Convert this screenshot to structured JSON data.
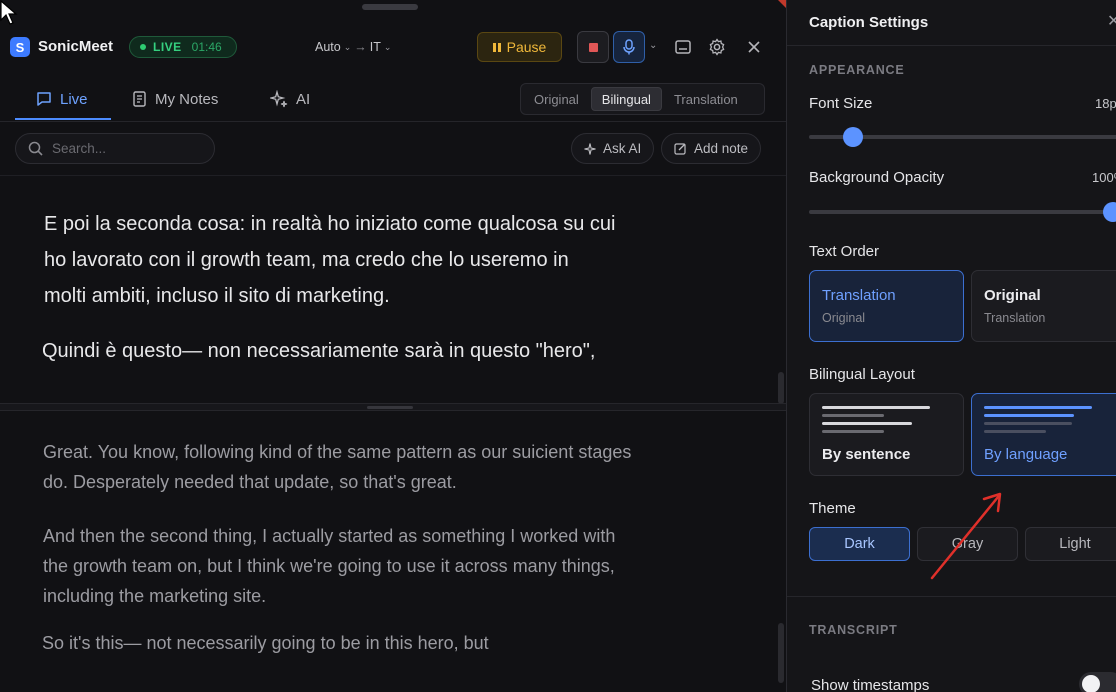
{
  "app": {
    "name": "SonicMeet",
    "logo_letter": "S",
    "live_label": "LIVE",
    "elapsed": "01:46",
    "source_lang": "Auto",
    "lang_separator": "→",
    "target_lang": "IT",
    "pause_label": "Pause"
  },
  "tabs": [
    {
      "label": "Live",
      "icon": "chat-icon",
      "active": true
    },
    {
      "label": "My Notes",
      "icon": "notes-icon",
      "active": false
    },
    {
      "label": "AI",
      "icon": "sparkles-icon",
      "active": false
    }
  ],
  "modes": [
    "Original",
    "Bilingual",
    "Translation"
  ],
  "active_mode": "Bilingual",
  "search": {
    "placeholder": "Search..."
  },
  "actions": {
    "ask_ai": "Ask AI",
    "add_note": "Add note"
  },
  "transcript_translated": [
    "E poi la seconda cosa: in realtà ho iniziato come qualcosa su cui",
    "ho lavorato con il growth team, ma credo che lo useremo in",
    "molti ambiti, incluso il sito di marketing.",
    "Quindi è questo— non necessariamente sarà in questo \"hero\","
  ],
  "transcript_original": [
    [
      "Great. You know, following kind of the same pattern as our suicient stages",
      "do. Desperately needed that update, so that's great."
    ],
    [
      "And then the second thing, I actually started as something I worked with",
      "the growth team on, but I think we're going to use it across many things,",
      "including the marketing site."
    ],
    [
      "So it's this— not necessarily going to be in this hero, but"
    ]
  ],
  "settings": {
    "title": "Caption Settings",
    "appearance_section": "APPEARANCE",
    "font_size_label": "Font Size",
    "font_size_value": "18p",
    "font_size_fraction": 0.14,
    "bg_opacity_label": "Background Opacity",
    "bg_opacity_value": "100%",
    "bg_opacity_fraction": 1.0,
    "text_order_label": "Text Order",
    "text_order": [
      {
        "title": "Translation",
        "subtitle": "Original",
        "selected": true
      },
      {
        "title": "Original",
        "subtitle": "Translation",
        "selected": false
      }
    ],
    "bilingual_layout_label": "Bilingual Layout",
    "layouts": [
      {
        "title": "By sentence",
        "selected": false
      },
      {
        "title": "By language",
        "selected": true
      }
    ],
    "theme_label": "Theme",
    "themes": [
      "Dark",
      "Gray",
      "Light"
    ],
    "active_theme": "Dark",
    "transcript_section": "TRANSCRIPT",
    "show_timestamps_label": "Show timestamps"
  },
  "colors": {
    "accent": "#4d8cff",
    "live_green": "#35d07f",
    "pause_amber": "#f0b83a",
    "stop_red": "#e15757",
    "annotation_arrow": "#e0302a"
  }
}
